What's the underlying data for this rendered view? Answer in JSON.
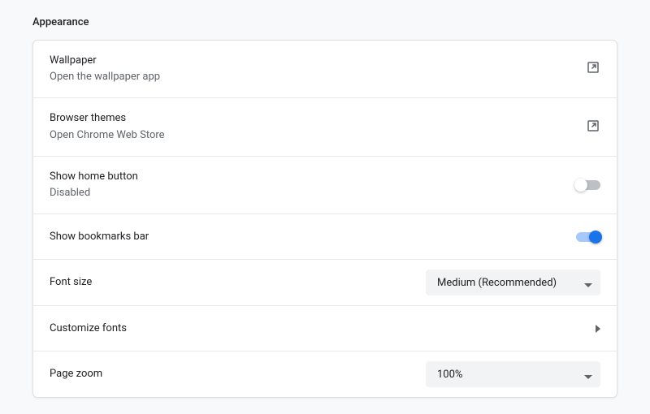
{
  "section": {
    "title": "Appearance"
  },
  "rows": {
    "wallpaper": {
      "title": "Wallpaper",
      "subtitle": "Open the wallpaper app"
    },
    "themes": {
      "title": "Browser themes",
      "subtitle": "Open Chrome Web Store"
    },
    "home_button": {
      "title": "Show home button",
      "subtitle": "Disabled",
      "enabled": false
    },
    "bookmarks_bar": {
      "title": "Show bookmarks bar",
      "enabled": true
    },
    "font_size": {
      "title": "Font size",
      "value": "Medium (Recommended)"
    },
    "customize_fonts": {
      "title": "Customize fonts"
    },
    "page_zoom": {
      "title": "Page zoom",
      "value": "100%"
    }
  }
}
